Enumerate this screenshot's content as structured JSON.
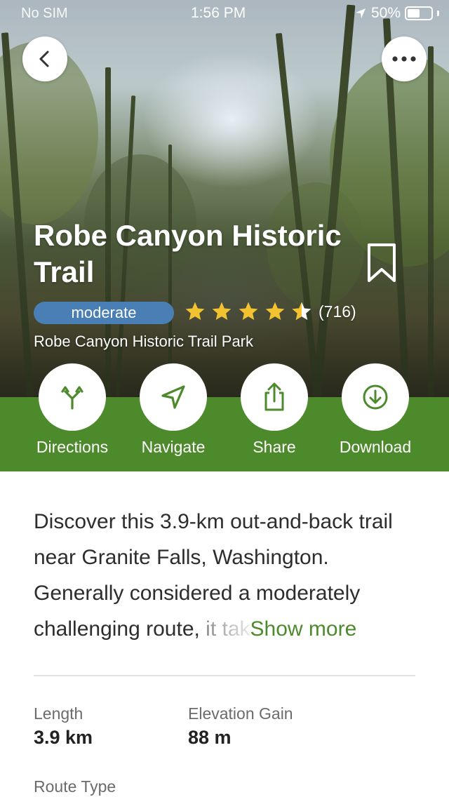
{
  "status_bar": {
    "carrier": "No SIM",
    "time": "1:56 PM",
    "battery": "50%"
  },
  "header": {
    "back_icon": "chevron-left-icon",
    "more_icon": "ellipsis-icon"
  },
  "trail": {
    "title": "Robe Canyon Historic Trail",
    "difficulty": "moderate",
    "rating": 4.5,
    "rating_count": "(716)",
    "park": "Robe Canyon Historic Trail Park",
    "bookmark_icon": "bookmark-icon"
  },
  "actions": [
    {
      "label": "Directions",
      "icon": "directions-fork-icon"
    },
    {
      "label": "Navigate",
      "icon": "navigate-arrow-icon"
    },
    {
      "label": "Share",
      "icon": "share-icon"
    },
    {
      "label": "Download",
      "icon": "download-icon"
    }
  ],
  "description": {
    "text": "Discover this 3.9-km out-and-back trail near Granite Falls, Washington. Generally considered a moderately challenging route, ",
    "faded": "it tak",
    "show_more": "Show more"
  },
  "stats": {
    "length_label": "Length",
    "length_value": "3.9 km",
    "elevation_label": "Elevation Gain",
    "elevation_value": "88 m",
    "route_type_label": "Route Type"
  },
  "colors": {
    "brand_green": "#4d8a2c",
    "difficulty_blue": "#4a7fb5",
    "star_yellow": "#f2c230"
  }
}
